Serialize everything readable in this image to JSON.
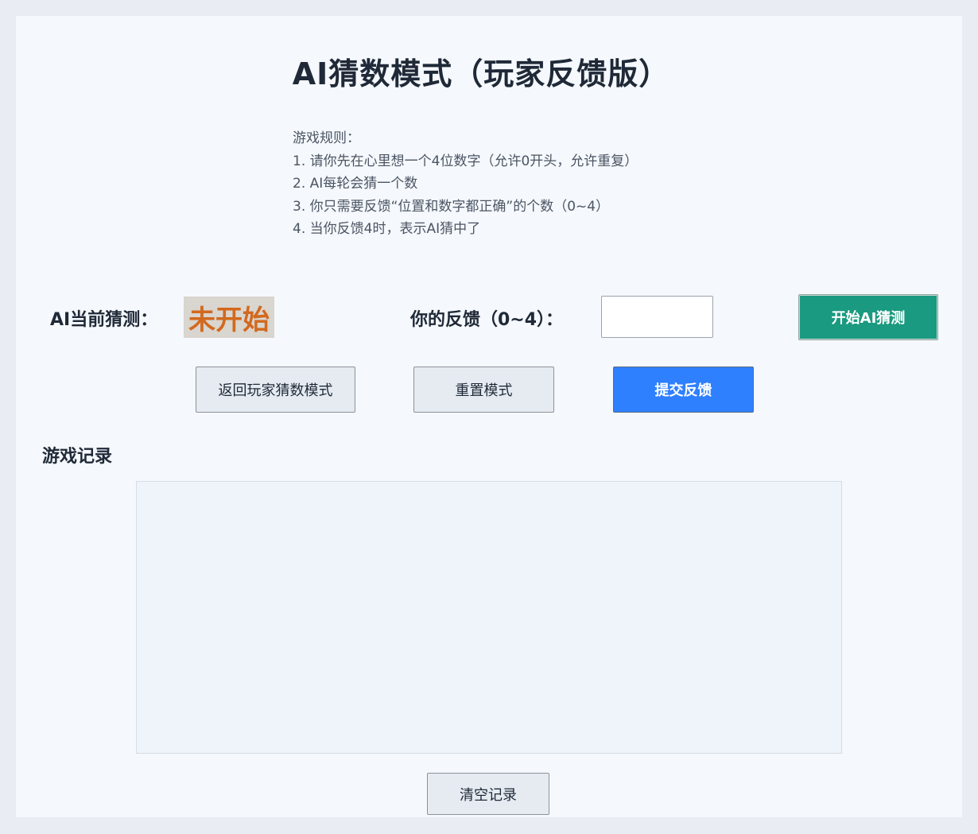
{
  "title": "AI猜数模式（玩家反馈版）",
  "rules": {
    "heading": "游戏规则：",
    "items": [
      "1. 请你先在心里想一个4位数字（允许0开头，允许重复）",
      "2. AI每轮会猜一个数",
      "3. 你只需要反馈“位置和数字都正确”的个数（0~4）",
      "4. 当你反馈4时，表示AI猜中了"
    ]
  },
  "current_guess": {
    "label": "AI当前猜测：",
    "value": "未开始"
  },
  "feedback": {
    "label": "你的反馈（0~4）：",
    "value": "",
    "placeholder": ""
  },
  "buttons": {
    "start": "开始AI猜测",
    "back": "返回玩家猜数模式",
    "reset": "重置模式",
    "submit": "提交反馈",
    "clear": "清空记录"
  },
  "record": {
    "label": "游戏记录",
    "entries": []
  },
  "colors": {
    "accent_green": "#1a9a80",
    "accent_blue": "#2f80ff",
    "guess_text": "#d2691e"
  }
}
